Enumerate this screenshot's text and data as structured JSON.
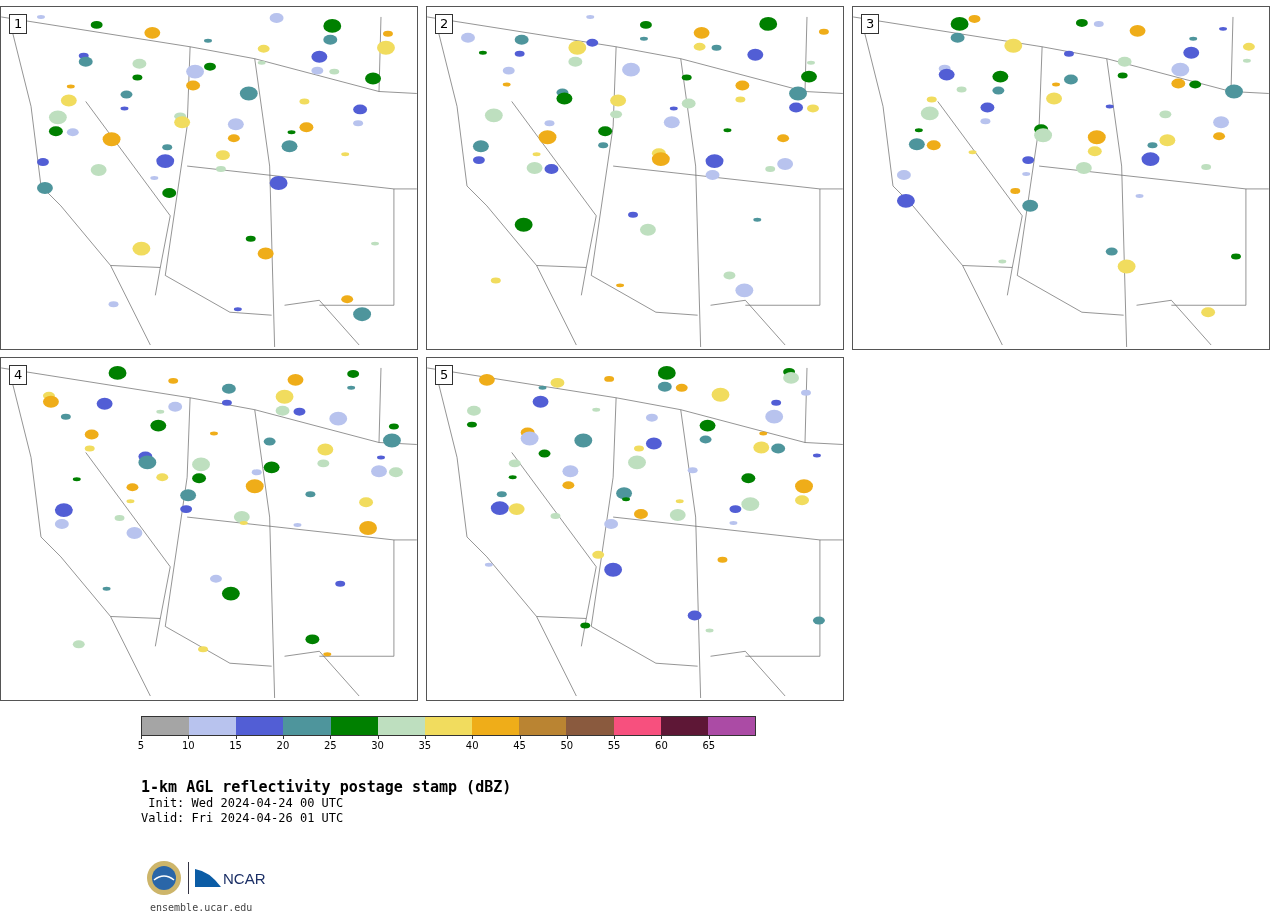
{
  "panels": [
    {
      "label": "1"
    },
    {
      "label": "2"
    },
    {
      "label": "3"
    },
    {
      "label": "4"
    },
    {
      "label": "5"
    }
  ],
  "legend": {
    "bins": [
      {
        "label": "5",
        "color": "#a5a5a5"
      },
      {
        "label": "10",
        "color": "#b8c3ee"
      },
      {
        "label": "15",
        "color": "#525ed5"
      },
      {
        "label": "20",
        "color": "#4e959c"
      },
      {
        "label": "25",
        "color": "#008000"
      },
      {
        "label": "30",
        "color": "#bedfbf"
      },
      {
        "label": "35",
        "color": "#f1dc5e"
      },
      {
        "label": "40",
        "color": "#efad19"
      },
      {
        "label": "45",
        "color": "#ba8432"
      },
      {
        "label": "50",
        "color": "#8a5a3e"
      },
      {
        "label": "55",
        "color": "#f7507e"
      },
      {
        "label": "60",
        "color": "#5e1736"
      },
      {
        "label": "65",
        "color": "#ab4ba5"
      }
    ]
  },
  "caption": {
    "title": "1-km AGL reflectivity postage stamp (dBZ)",
    "init": " Init: Wed 2024-04-24 00 UTC",
    "valid": "Valid: Fri 2024-04-26 01 UTC"
  },
  "footer": {
    "logo_text": "NCAR",
    "url": "ensemble.ucar.edu"
  }
}
